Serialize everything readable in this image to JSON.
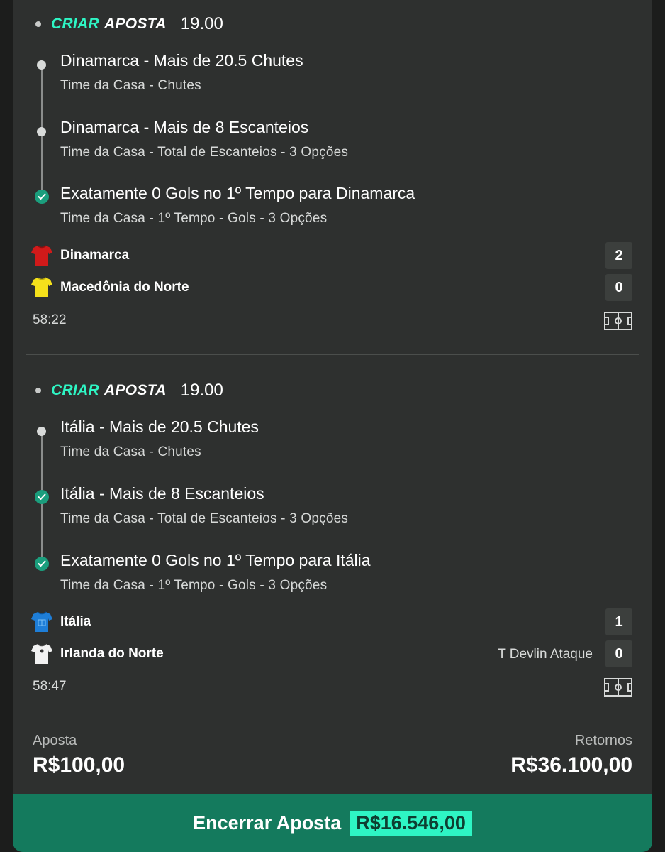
{
  "bets": [
    {
      "brand_part1": "CRIAR",
      "brand_part2": "APOSTA",
      "odds": "19.00",
      "selections": [
        {
          "title": "Dinamarca - Mais de 20.5 Chutes",
          "subtitle": "Time da Casa - Chutes",
          "won": false
        },
        {
          "title": "Dinamarca - Mais de 8 Escanteios",
          "subtitle": "Time da Casa - Total de Escanteios - 3 Opções",
          "won": false
        },
        {
          "title": "Exatamente 0 Gols no 1º Tempo para Dinamarca",
          "subtitle": "Time da Casa - 1º Tempo - Gols - 3 Opções",
          "won": true
        }
      ],
      "home": {
        "name": "Dinamarca",
        "score": "2",
        "shirt_color": "#d11a1a"
      },
      "away": {
        "name": "Macedônia do Norte",
        "score": "0",
        "shirt_color": "#f5e11b",
        "scorer": ""
      },
      "clock": "58:22"
    },
    {
      "brand_part1": "CRIAR",
      "brand_part2": "APOSTA",
      "odds": "19.00",
      "selections": [
        {
          "title": "Itália - Mais de 20.5 Chutes",
          "subtitle": "Time da Casa - Chutes",
          "won": false
        },
        {
          "title": "Itália - Mais de 8 Escanteios",
          "subtitle": "Time da Casa - Total de Escanteios - 3 Opções",
          "won": true
        },
        {
          "title": "Exatamente 0 Gols no 1º Tempo para Itália",
          "subtitle": "Time da Casa - 1º Tempo - Gols - 3 Opções",
          "won": true
        }
      ],
      "home": {
        "name": "Itália",
        "score": "1",
        "shirt_color": "#1e7ed8"
      },
      "away": {
        "name": "Irlanda do Norte",
        "score": "0",
        "shirt_color": "#f2f2f2",
        "scorer": "T Devlin Ataque"
      },
      "clock": "58:47"
    }
  ],
  "footer": {
    "stake_label": "Aposta",
    "stake_value": "R$100,00",
    "returns_label": "Retornos",
    "returns_value": "R$36.100,00"
  },
  "cashout": {
    "label": "Encerrar Aposta",
    "amount": "R$16.546,00"
  },
  "colors": {
    "accent": "#2ef5c4",
    "cashout_bg": "#147a5d",
    "check_green": "#1b9e7d",
    "card_bg": "#2e302f"
  },
  "icons": {
    "selection_pending": "dot-icon",
    "selection_won": "check-icon",
    "match_view": "pitch-icon",
    "team": "shirt-icon"
  }
}
